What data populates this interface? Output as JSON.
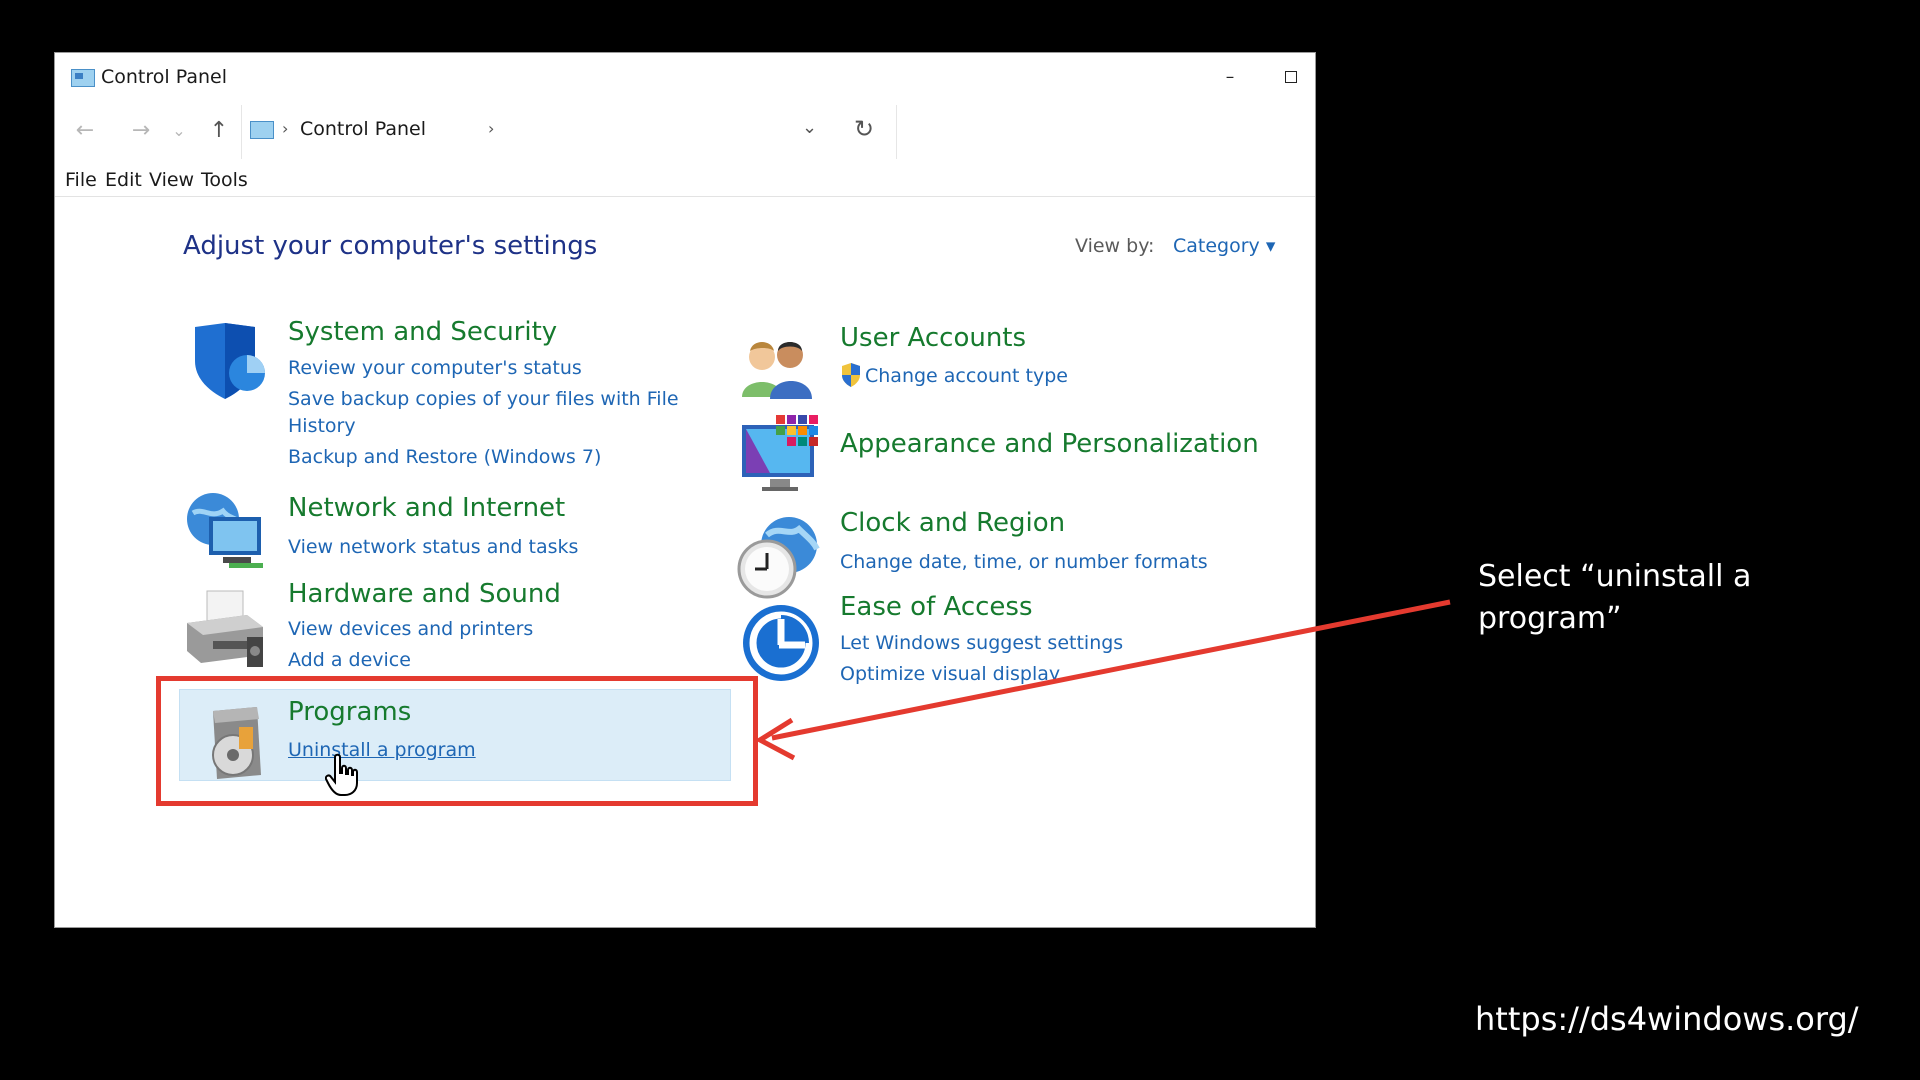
{
  "window": {
    "title": "Control Panel",
    "min_glyph": "–"
  },
  "navbar": {
    "back_glyph": "←",
    "forward_glyph": "→",
    "recent_glyph": "⌄",
    "up_glyph": "↑",
    "breadcrumb_sep": "›",
    "address_text": "Control Panel",
    "dropdown_glyph": "⌄",
    "refresh_glyph": "↻"
  },
  "menu": [
    "File",
    "Edit",
    "View",
    "Tools"
  ],
  "main": {
    "heading": "Adjust your computer's settings",
    "view_by_label": "View by:",
    "view_by_value": "Category ▾"
  },
  "categories": {
    "system_security": {
      "title": "System and Security",
      "links": [
        "Review your computer's status",
        "Save backup copies of your files with File",
        "History",
        "Backup and Restore (Windows 7)"
      ]
    },
    "network": {
      "title": "Network and Internet",
      "links": [
        "View network status and tasks"
      ]
    },
    "hardware": {
      "title": "Hardware and Sound",
      "links": [
        "View devices and printers",
        "Add a device"
      ]
    },
    "programs": {
      "title": "Programs",
      "links": [
        "Uninstall a program"
      ]
    },
    "user_accounts": {
      "title": "User Accounts",
      "links": [
        "Change account type"
      ]
    },
    "appearance": {
      "title": "Appearance and Personalization",
      "links": []
    },
    "clock": {
      "title": "Clock and Region",
      "links": [
        "Change date, time, or number formats"
      ]
    },
    "ease": {
      "title": "Ease of Access",
      "links": [
        "Let Windows suggest settings",
        "Optimize visual display"
      ]
    }
  },
  "annotation": {
    "text": "Select “uninstall a program”",
    "color": "#e43a2f"
  },
  "footer": {
    "url": "https://ds4windows.org/"
  },
  "colors": {
    "category_title": "#167a2e",
    "link": "#1e66b4",
    "heading": "#1e3287",
    "programs_highlight": "#dcedf8"
  }
}
